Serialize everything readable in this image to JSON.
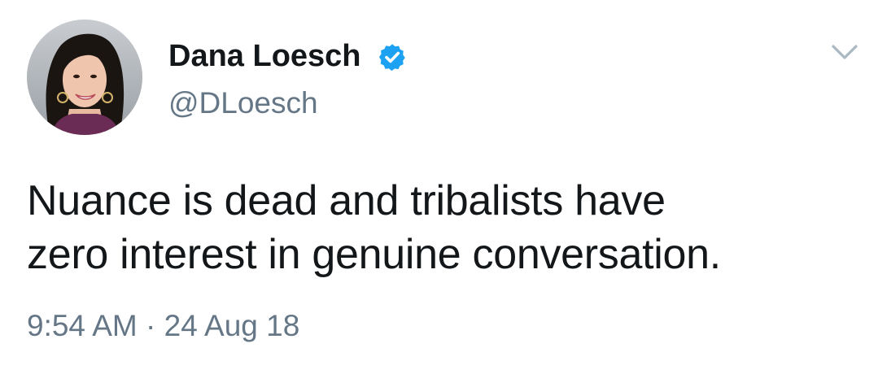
{
  "tweet": {
    "author": {
      "display_name": "Dana Loesch",
      "handle": "@DLoesch",
      "verified": true,
      "verified_icon": "verified-badge-icon",
      "verified_color": "#1da1f2"
    },
    "text_lines": [
      "Nuance is dead and tribalists have",
      "zero interest in genuine conversation."
    ],
    "timestamp": "9:54 AM · 24 Aug 18",
    "menu_icon": "chevron-down-icon"
  },
  "colors": {
    "text_primary": "#14171a",
    "text_secondary": "#657786",
    "caret": "#aab8c2",
    "background": "#ffffff"
  }
}
